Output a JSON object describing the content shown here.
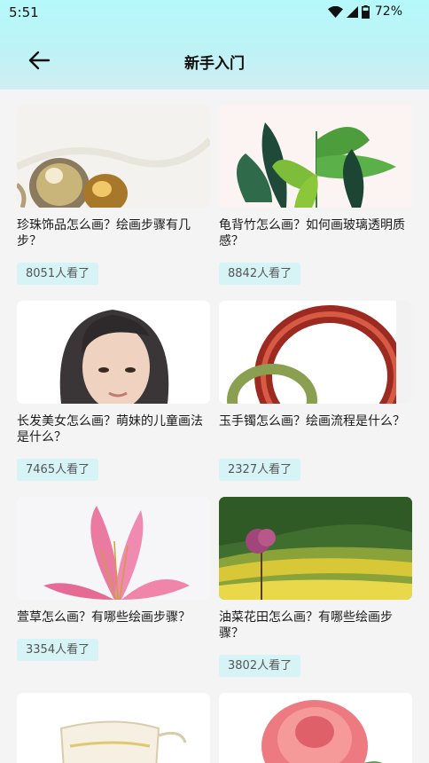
{
  "status": {
    "time": "5:51",
    "battery": "72%"
  },
  "header": {
    "title": "新手入门"
  },
  "articles": [
    {
      "title": "珍珠饰品怎么画？绘画步骤有几步？",
      "views": "8051",
      "views_suffix": "人看了",
      "icon": "pearl-illustration"
    },
    {
      "title": "龟背竹怎么画？如何画玻璃透明质感？",
      "views": "8842",
      "views_suffix": "人看了",
      "icon": "monstera-illustration"
    },
    {
      "title": "长发美女怎么画？萌妹的儿童画法是什么？",
      "views": "7465",
      "views_suffix": "人看了",
      "icon": "portrait-illustration"
    },
    {
      "title": "玉手镯怎么画？绘画流程是什么？",
      "views": "2327",
      "views_suffix": "人看了",
      "icon": "bracelet-illustration"
    },
    {
      "title": "萱草怎么画？有哪些绘画步骤？",
      "views": "3354",
      "views_suffix": "人看了",
      "icon": "lily-illustration"
    },
    {
      "title": "油菜花田怎么画？有哪些绘画步骤？",
      "views": "3802",
      "views_suffix": "人看了",
      "icon": "rapeseed-field-illustration"
    },
    {
      "title": "",
      "views": "",
      "views_suffix": "",
      "icon": "teapot-illustration"
    },
    {
      "title": "",
      "views": "",
      "views_suffix": "",
      "icon": "rose-illustration"
    }
  ]
}
